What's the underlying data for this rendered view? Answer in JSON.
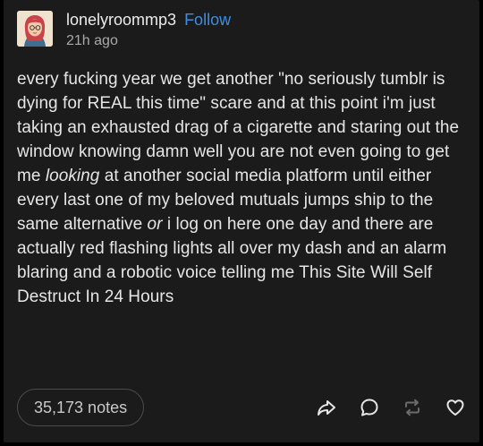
{
  "post": {
    "username": "lonelyroommp3",
    "follow_label": "Follow",
    "timestamp": "21h ago",
    "body": {
      "p1": "every fucking year we get another \"no seriously tumblr is dying for REAL this time\" scare and at this point i'm just taking an exhausted drag of a cigarette and staring out the window knowing damn well you are not even going to get me ",
      "emph1": "looking",
      "p2": " at another social media platform until either every last one of my beloved mutuals jumps ship to the same alternative ",
      "emph2": "or",
      "p3": " i log on here one day and there are actually red flashing lights all over my dash and an alarm blaring and a robotic voice telling me This Site Will Self Destruct In 24 Hours"
    },
    "notes_label": "35,173 notes"
  },
  "icons": {
    "share": "share-icon",
    "reply": "reply-icon",
    "reblog": "reblog-icon",
    "like": "heart-icon"
  },
  "colors": {
    "background": "#1b1b1b",
    "text": "#e6e6e6",
    "follow": "#3d8ee3",
    "muted": "#a9a9a9",
    "reblog_disabled": "#6b6b6b"
  }
}
